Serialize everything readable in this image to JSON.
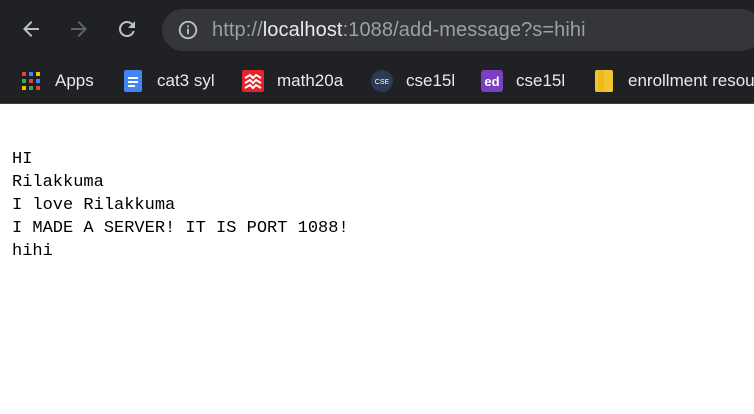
{
  "browser": {
    "url_scheme": "http://",
    "url_host": "localhost",
    "url_rest": ":1088/add-message?s=hihi"
  },
  "bookmarks": [
    {
      "label": "Apps",
      "icon": "apps-grid-icon"
    },
    {
      "label": "cat3 syl",
      "icon": "google-docs-icon"
    },
    {
      "label": "math20a",
      "icon": "textbook-icon"
    },
    {
      "label": "cse15l",
      "icon": "cse-icon"
    },
    {
      "label": "cse15l",
      "icon": "ed-icon"
    },
    {
      "label": "enrollment resou",
      "icon": "folder-icon"
    }
  ],
  "page": {
    "lines": [
      "HI",
      "Rilakkuma",
      "I love Rilakkuma",
      "I MADE A SERVER! IT IS PORT 1088!",
      "hihi"
    ]
  },
  "colors": {
    "toolbar": "#202124",
    "omnibox": "#35363a",
    "page_bg": "#ffffff"
  }
}
